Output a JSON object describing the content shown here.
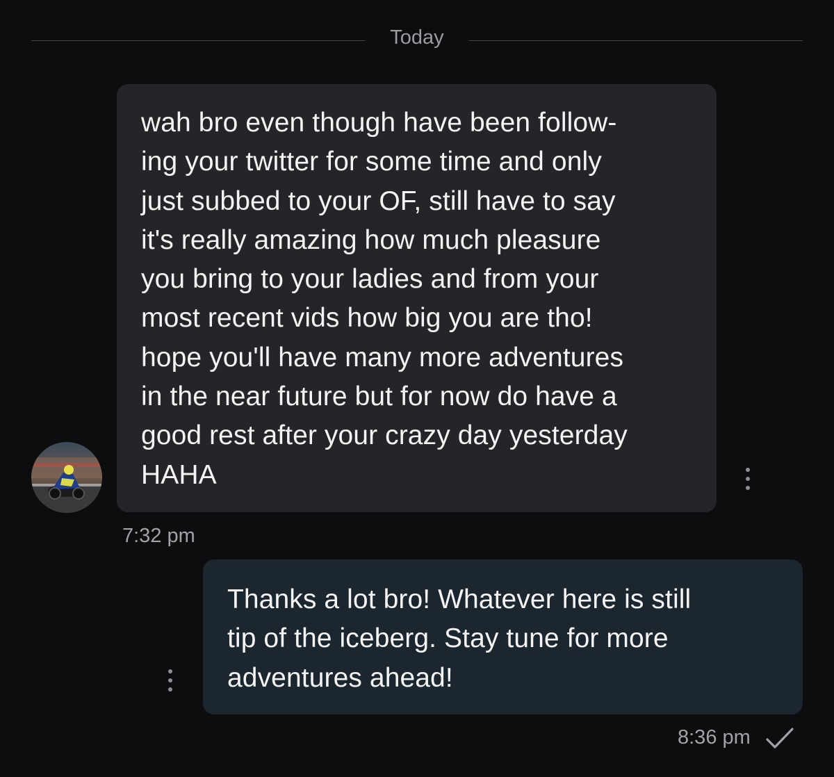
{
  "date_divider": {
    "label": "Today"
  },
  "incoming_message": {
    "text": "wah bro even though have been follow-\ning your twitter for some time and only\njust subbed to your OF, still have to say\nit's really amazing how much pleasure\nyou bring to your ladies and from your\nmost recent vids how big you are tho!\nhope you'll have many more adventures\nin the near future but for now do have a\ngood rest after your crazy day yesterday\nHAHA",
    "time": "7:32 pm",
    "avatar_icon": "motorcycle-racer-avatar",
    "menu_icon": "more-vertical-icon",
    "bubble_color": "#252529"
  },
  "outgoing_message": {
    "text": "Thanks a lot bro! Whatever here is still\ntip of the iceberg. Stay tune for more\nadventures ahead!",
    "time": "8:36 pm",
    "status_icon": "checkmark-icon",
    "menu_icon": "more-vertical-icon",
    "bubble_color": "#1b262e"
  },
  "colors": {
    "background": "#0d0d0f",
    "text": "#f4f4f4",
    "muted": "#9b9ba0"
  }
}
